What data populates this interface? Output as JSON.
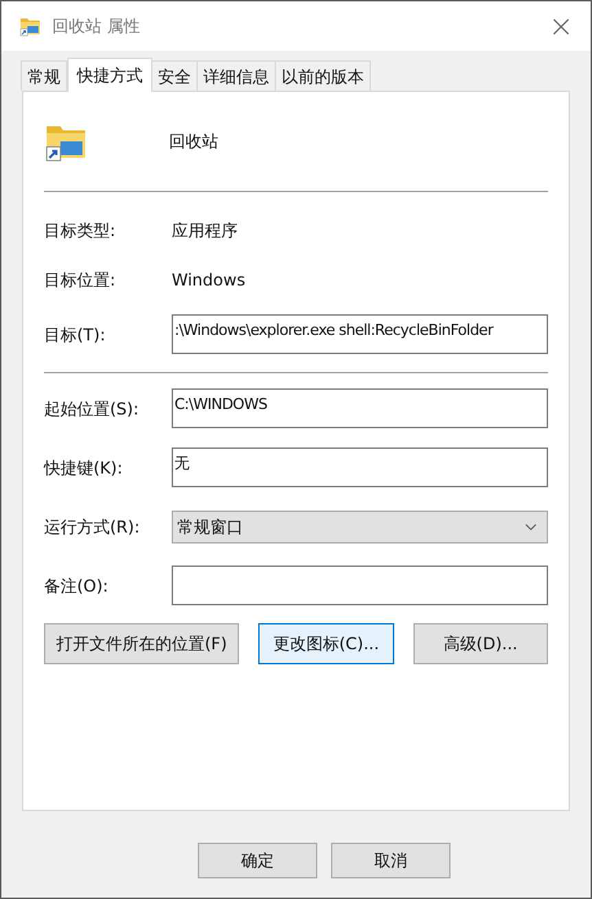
{
  "window": {
    "title": "回收站 属性"
  },
  "tabs": [
    {
      "label": "常规",
      "selected": false
    },
    {
      "label": "快捷方式",
      "selected": true
    },
    {
      "label": "安全",
      "selected": false
    },
    {
      "label": "详细信息",
      "selected": false
    },
    {
      "label": "以前的版本",
      "selected": false
    }
  ],
  "header": {
    "name": "回收站"
  },
  "info_rows": [
    {
      "label": "目标类型:",
      "value": "应用程序",
      "kind": "text"
    },
    {
      "label": "目标位置:",
      "value": "Windows",
      "kind": "text"
    },
    {
      "label": "目标(T):",
      "value": ":\\Windows\\explorer.exe shell:RecycleBinFolder",
      "kind": "input"
    }
  ],
  "settings_rows": [
    {
      "label": "起始位置(S):",
      "value": "C:\\WINDOWS",
      "kind": "input"
    },
    {
      "label": "快捷键(K):",
      "value": "无",
      "kind": "input"
    },
    {
      "label": "运行方式(R):",
      "value": "常规窗口",
      "kind": "select"
    },
    {
      "label": "备注(O):",
      "kind": "input"
    }
  ],
  "action_buttons": [
    {
      "label": "打开文件所在的位置(F)",
      "focused": false
    },
    {
      "label": "更改图标(C)...",
      "focused": true
    },
    {
      "label": "高级(D)...",
      "focused": false
    }
  ],
  "dialog_buttons": [
    "确定",
    "取消"
  ]
}
